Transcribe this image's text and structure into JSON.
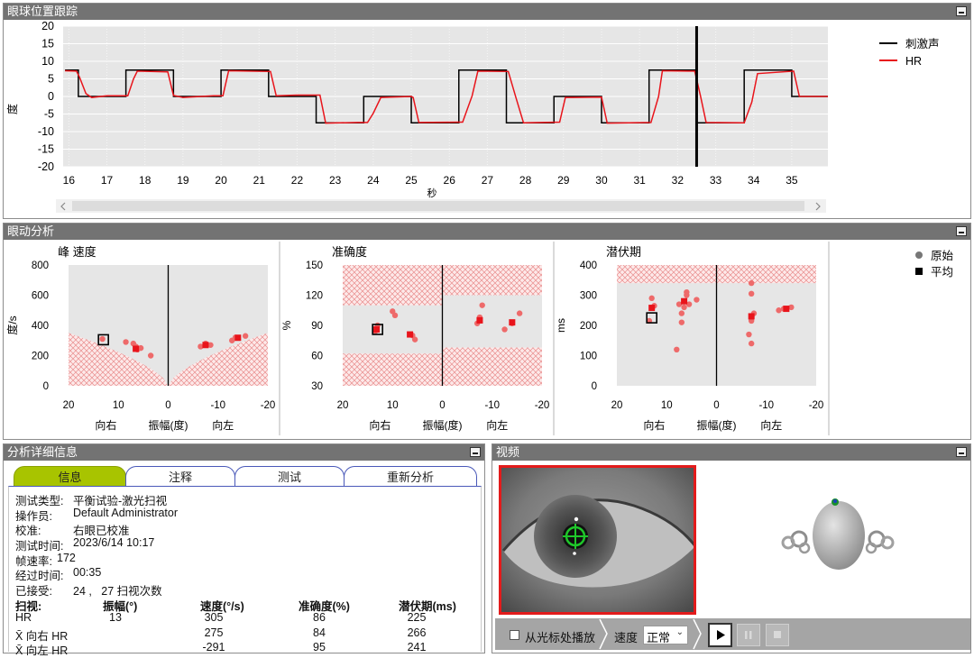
{
  "panels": {
    "eye_tracking": "眼球位置跟踪",
    "eye_movement": "眼动分析",
    "details": "分析详细信息",
    "video": "视频"
  },
  "tracking_chart": {
    "type": "line",
    "ylabel": "度",
    "xlabel": "秒",
    "yticks": [
      "20",
      "15",
      "10",
      "5",
      "0",
      "-5",
      "-10",
      "-15",
      "-20"
    ],
    "xticks": [
      "16",
      "17",
      "18",
      "19",
      "20",
      "21",
      "22",
      "23",
      "24",
      "25",
      "26",
      "27",
      "28",
      "29",
      "30",
      "31",
      "32",
      "33",
      "34",
      "35"
    ],
    "ylim": [
      -20,
      20
    ],
    "xlim": [
      15.85,
      35.95
    ],
    "cursor_x": 32.5,
    "legend": [
      "刺激声",
      "HR"
    ],
    "colors": {
      "stimulus": "#000000",
      "hr": "#e8141b"
    },
    "stimulus": [
      [
        15.9,
        7.5
      ],
      [
        16.25,
        7.5
      ],
      [
        16.25,
        0
      ],
      [
        17.5,
        0
      ],
      [
        17.5,
        7.5
      ],
      [
        18.75,
        7.5
      ],
      [
        18.75,
        0
      ],
      [
        20.0,
        0
      ],
      [
        20.0,
        7.5
      ],
      [
        21.25,
        7.5
      ],
      [
        21.25,
        0
      ],
      [
        22.5,
        0
      ],
      [
        22.5,
        -7.5
      ],
      [
        23.75,
        -7.5
      ],
      [
        23.75,
        0
      ],
      [
        25.0,
        0
      ],
      [
        25.0,
        -7.5
      ],
      [
        26.25,
        -7.5
      ],
      [
        26.25,
        7.5
      ],
      [
        27.5,
        7.5
      ],
      [
        27.5,
        -7.5
      ],
      [
        28.75,
        -7.5
      ],
      [
        28.75,
        0
      ],
      [
        30.0,
        0
      ],
      [
        30.0,
        -7.5
      ],
      [
        31.25,
        -7.5
      ],
      [
        31.25,
        7.5
      ],
      [
        32.5,
        7.5
      ],
      [
        32.5,
        -7.5
      ],
      [
        33.75,
        -7.5
      ],
      [
        33.75,
        7.5
      ],
      [
        35.0,
        7.5
      ],
      [
        35.0,
        0
      ],
      [
        35.95,
        0
      ]
    ],
    "hr": [
      [
        15.9,
        7.3
      ],
      [
        16.2,
        7.2
      ],
      [
        16.28,
        5.5
      ],
      [
        16.45,
        0.8
      ],
      [
        16.6,
        -0.3
      ],
      [
        17.0,
        0.2
      ],
      [
        17.55,
        0.2
      ],
      [
        17.7,
        5.0
      ],
      [
        17.8,
        7.2
      ],
      [
        18.6,
        7.0
      ],
      [
        18.75,
        0.3
      ],
      [
        19.0,
        -0.3
      ],
      [
        19.8,
        0.2
      ],
      [
        20.05,
        0.2
      ],
      [
        20.2,
        7.3
      ],
      [
        21.3,
        7.1
      ],
      [
        21.45,
        0.2
      ],
      [
        22.0,
        0.4
      ],
      [
        22.6,
        0.4
      ],
      [
        22.75,
        -7.6
      ],
      [
        23.6,
        -7.4
      ],
      [
        23.85,
        -7.4
      ],
      [
        24.0,
        -4.8
      ],
      [
        24.2,
        -0.3
      ],
      [
        25.0,
        0.0
      ],
      [
        25.05,
        -0.3
      ],
      [
        25.2,
        -7.4
      ],
      [
        26.35,
        -7.3
      ],
      [
        26.6,
        0.2
      ],
      [
        26.75,
        7.2
      ],
      [
        27.55,
        7.1
      ],
      [
        27.75,
        -0.3
      ],
      [
        27.95,
        -7.5
      ],
      [
        28.9,
        -7.3
      ],
      [
        29.05,
        -0.3
      ],
      [
        30.0,
        -0.2
      ],
      [
        30.15,
        -7.6
      ],
      [
        31.3,
        -7.4
      ],
      [
        31.5,
        0.0
      ],
      [
        31.6,
        7.3
      ],
      [
        32.45,
        7.2
      ],
      [
        32.6,
        0.2
      ],
      [
        32.75,
        -7.4
      ],
      [
        33.75,
        -7.5
      ],
      [
        33.95,
        -1.6
      ],
      [
        34.1,
        6.5
      ],
      [
        35.05,
        7.2
      ],
      [
        35.2,
        0.0
      ],
      [
        35.95,
        0.0
      ]
    ]
  },
  "analysis": {
    "legend": {
      "raw": "原始",
      "avg": "平均"
    },
    "x_labels": {
      "right": "向右",
      "amp": "振幅(度)",
      "left": "向左"
    },
    "xticks": [
      "20",
      "10",
      "0",
      "-10",
      "-20"
    ],
    "charts": [
      {
        "title": "峰 速度",
        "ylabel": "度/s",
        "yticks": [
          "800",
          "600",
          "400",
          "200",
          "0"
        ],
        "ylim": [
          0,
          800
        ],
        "raw": [
          [
            13.2,
            310
          ],
          [
            8.5,
            290
          ],
          [
            6.5,
            260
          ],
          [
            6.2,
            240
          ],
          [
            5.5,
            250
          ],
          [
            7.0,
            280
          ],
          [
            3.5,
            200
          ],
          [
            -6.5,
            260
          ],
          [
            -7.5,
            280
          ],
          [
            -8.5,
            270
          ],
          [
            -12.8,
            300
          ],
          [
            -13.5,
            320
          ],
          [
            -15.5,
            330
          ]
        ],
        "avg": [
          [
            6.5,
            245
          ],
          [
            -7.5,
            270
          ],
          [
            -14.0,
            318
          ]
        ],
        "selected": [
          13.0,
          305
        ]
      },
      {
        "title": "准确度",
        "ylabel": "%",
        "yticks": [
          "150",
          "120",
          "90",
          "60",
          "30"
        ],
        "ylim": [
          30,
          150
        ],
        "raw": [
          [
            13.5,
            84
          ],
          [
            13.0,
            90
          ],
          [
            10.0,
            104
          ],
          [
            9.5,
            100
          ],
          [
            6.0,
            80
          ],
          [
            5.5,
            76
          ],
          [
            -7.0,
            92
          ],
          [
            -7.5,
            98
          ],
          [
            -8.0,
            110
          ],
          [
            -14.0,
            92
          ],
          [
            -15.5,
            102
          ],
          [
            -12.5,
            86
          ]
        ],
        "avg": [
          [
            13.2,
            86
          ],
          [
            6.5,
            81
          ],
          [
            -7.5,
            95
          ],
          [
            -14.0,
            93
          ]
        ],
        "selected": [
          13.0,
          86
        ]
      },
      {
        "title": "潜伏期",
        "ylabel": "ms",
        "yticks": [
          "400",
          "300",
          "200",
          "100",
          "0"
        ],
        "ylim": [
          0,
          400
        ],
        "raw": [
          [
            13.0,
            290
          ],
          [
            12.5,
            265
          ],
          [
            13.5,
            215
          ],
          [
            7.5,
            270
          ],
          [
            7.0,
            240
          ],
          [
            6.5,
            260
          ],
          [
            6.0,
            300
          ],
          [
            6.0,
            310
          ],
          [
            5.5,
            270
          ],
          [
            7.0,
            210
          ],
          [
            8.0,
            120
          ],
          [
            4.0,
            285
          ],
          [
            -7.0,
            340
          ],
          [
            -7.0,
            305
          ],
          [
            -7.5,
            240
          ],
          [
            -7.0,
            215
          ],
          [
            -6.5,
            170
          ],
          [
            -7.0,
            140
          ],
          [
            -12.5,
            250
          ],
          [
            -13.5,
            255
          ],
          [
            -15.0,
            260
          ]
        ],
        "avg": [
          [
            13.0,
            258
          ],
          [
            6.5,
            280
          ],
          [
            -7.0,
            230
          ],
          [
            -14.0,
            255
          ]
        ],
        "selected": [
          13.0,
          225
        ]
      }
    ]
  },
  "details": {
    "tabs": [
      "信息",
      "注释",
      "测试",
      "重新分析"
    ],
    "info": [
      {
        "label": "测试类型:",
        "value": "平衡试验-激光扫视"
      },
      {
        "label": "操作员:",
        "value": "Default Administrator"
      },
      {
        "label": "校准:",
        "value": "右眼已校准"
      },
      {
        "label": "测试时间:",
        "value": "2023/6/14 10:17"
      },
      {
        "label": "帧速率:",
        "value": "172"
      },
      {
        "label": "经过时间:",
        "value": "00:35"
      },
      {
        "label": "已接受:",
        "value": "24 ,   27 扫视次数"
      }
    ],
    "table_headers": [
      "扫视:",
      "振幅(°)",
      "速度(°/s)",
      "准确度(%)",
      "潜伏期(ms)"
    ],
    "table_rows": [
      [
        "HR",
        "13",
        "305",
        "86",
        "225"
      ],
      [
        "X̄ 向右 HR",
        "",
        "275",
        "84",
        "266"
      ],
      [
        "X̄ 向左 HR",
        "",
        "-291",
        "95",
        "241"
      ]
    ]
  },
  "video": {
    "play_from_cursor": "从光标处播放",
    "speed_label": "速度",
    "speed_value": "正常"
  }
}
